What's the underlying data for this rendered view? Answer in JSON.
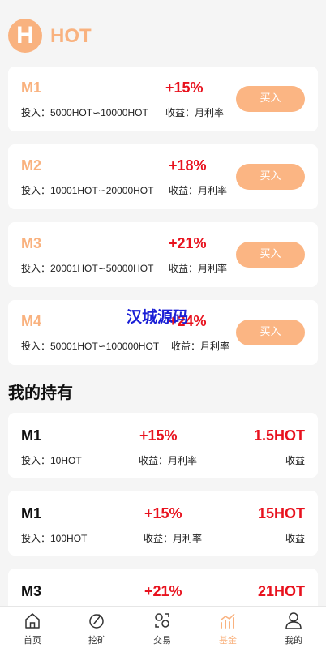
{
  "header": {
    "logo_letter": "H",
    "brand": "HOT"
  },
  "funds": [
    {
      "name": "M1",
      "rate": "+15%",
      "invest": "投入：5000HOT∽10000HOT",
      "profit": "收益：月利率",
      "buy_label": "买入"
    },
    {
      "name": "M2",
      "rate": "+18%",
      "invest": "投入：10001HOT∽20000HOT",
      "profit": "收益：月利率",
      "buy_label": "买入"
    },
    {
      "name": "M3",
      "rate": "+21%",
      "invest": "投入：20001HOT∽50000HOT",
      "profit": "收益：月利率",
      "buy_label": "买入"
    },
    {
      "name": "M4",
      "rate": "+24%",
      "invest": "投入：50001HOT∽100000HOT",
      "profit": "收益：月利率",
      "buy_label": "买入"
    }
  ],
  "watermark": "汉城源码",
  "holdings_title": "我的持有",
  "holdings": [
    {
      "name": "M1",
      "rate": "+15%",
      "amount": "1.5HOT",
      "invest": "投入：10HOT",
      "profit": "收益：月利率",
      "label": "收益"
    },
    {
      "name": "M1",
      "rate": "+15%",
      "amount": "15HOT",
      "invest": "投入：100HOT",
      "profit": "收益：月利率",
      "label": "收益"
    },
    {
      "name": "M3",
      "rate": "+21%",
      "amount": "21HOT",
      "invest": "",
      "profit": "",
      "label": ""
    }
  ],
  "tabbar": [
    {
      "label": "首页",
      "icon": "home-icon",
      "active": false
    },
    {
      "label": "挖矿",
      "icon": "mining-icon",
      "active": false
    },
    {
      "label": "交易",
      "icon": "trade-icon",
      "active": false
    },
    {
      "label": "基金",
      "icon": "fund-chart-icon",
      "active": true
    },
    {
      "label": "我的",
      "icon": "user-icon",
      "active": false
    }
  ],
  "colors": {
    "accent": "#f9b27f",
    "rate_red": "#e8121e",
    "watermark_blue": "#1a1fd6"
  }
}
